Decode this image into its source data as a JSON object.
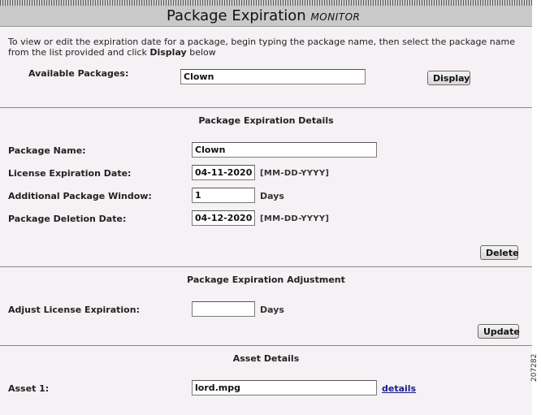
{
  "header": {
    "title": "Package Expiration",
    "subtitle": "MONITOR"
  },
  "intro": {
    "text": "To view or edit the expiration date for a package, begin typing the package name, then select the package name from the list provided and click ",
    "emphasis": "Display",
    "tail": " below"
  },
  "available": {
    "label": "Available Packages:",
    "value": "Clown",
    "button": "Display"
  },
  "details": {
    "title": "Package Expiration Details",
    "package_name_label": "Package Name:",
    "package_name_value": "Clown",
    "license_label": "License Expiration Date:",
    "license_value": "04-11-2020",
    "license_hint": "[MM-DD-YYYY]",
    "window_label": "Additional Package Window:",
    "window_value": "1",
    "window_unit": "Days",
    "deletion_label": "Package Deletion Date:",
    "deletion_value": "04-12-2020",
    "deletion_hint": "[MM-DD-YYYY]",
    "delete_button": "Delete"
  },
  "adjustment": {
    "title": "Package Expiration Adjustment",
    "adjust_label": "Adjust License Expiration:",
    "adjust_value": "",
    "adjust_unit": "Days",
    "update_button": "Update"
  },
  "assets": {
    "title": "Asset Details",
    "asset1_label": "Asset 1:",
    "asset1_value": "lord.mpg",
    "details_link": "details"
  },
  "figure_code": "207282"
}
